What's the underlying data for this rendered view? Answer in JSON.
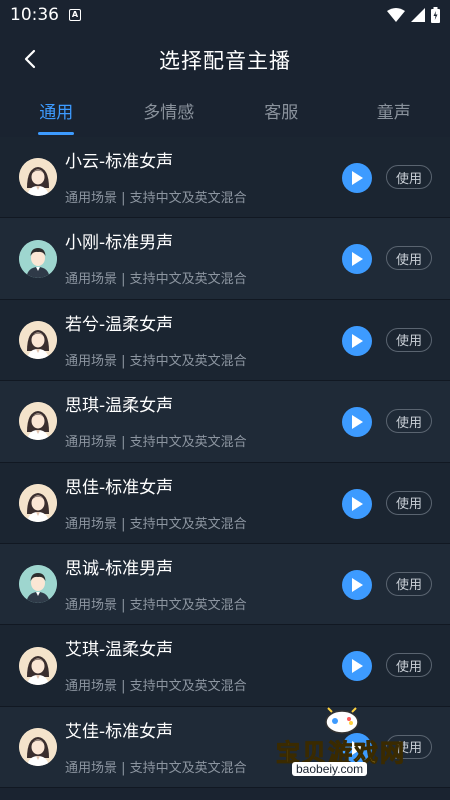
{
  "status_bar": {
    "time": "10:36",
    "a_badge": "A"
  },
  "header": {
    "title": "选择配音主播"
  },
  "tabs": [
    {
      "label": "通用",
      "active": true
    },
    {
      "label": "多情感",
      "active": false
    },
    {
      "label": "客服",
      "active": false
    },
    {
      "label": "童声",
      "active": false
    }
  ],
  "voices": [
    {
      "name": "小云-标准女声",
      "desc": "通用场景 | 支持中文及英文混合",
      "gender": "female",
      "use_label": "使用"
    },
    {
      "name": "小刚-标准男声",
      "desc": "通用场景 | 支持中文及英文混合",
      "gender": "male",
      "use_label": "使用"
    },
    {
      "name": "若兮-温柔女声",
      "desc": "通用场景 | 支持中文及英文混合",
      "gender": "female",
      "use_label": "使用"
    },
    {
      "name": "思琪-温柔女声",
      "desc": "通用场景 | 支持中文及英文混合",
      "gender": "female",
      "use_label": "使用"
    },
    {
      "name": "思佳-标准女声",
      "desc": "通用场景 | 支持中文及英文混合",
      "gender": "female",
      "use_label": "使用"
    },
    {
      "name": "思诚-标准男声",
      "desc": "通用场景 | 支持中文及英文混合",
      "gender": "male",
      "use_label": "使用"
    },
    {
      "name": "艾琪-温柔女声",
      "desc": "通用场景 | 支持中文及英文混合",
      "gender": "female",
      "use_label": "使用"
    },
    {
      "name": "艾佳-标准女声",
      "desc": "通用场景 | 支持中文及英文混合",
      "gender": "female",
      "use_label": "使用"
    }
  ],
  "watermark": {
    "text": "宝贝游戏网",
    "url": "baobeiy.com"
  },
  "colors": {
    "accent": "#3d9bff",
    "background": "#1a2330"
  }
}
